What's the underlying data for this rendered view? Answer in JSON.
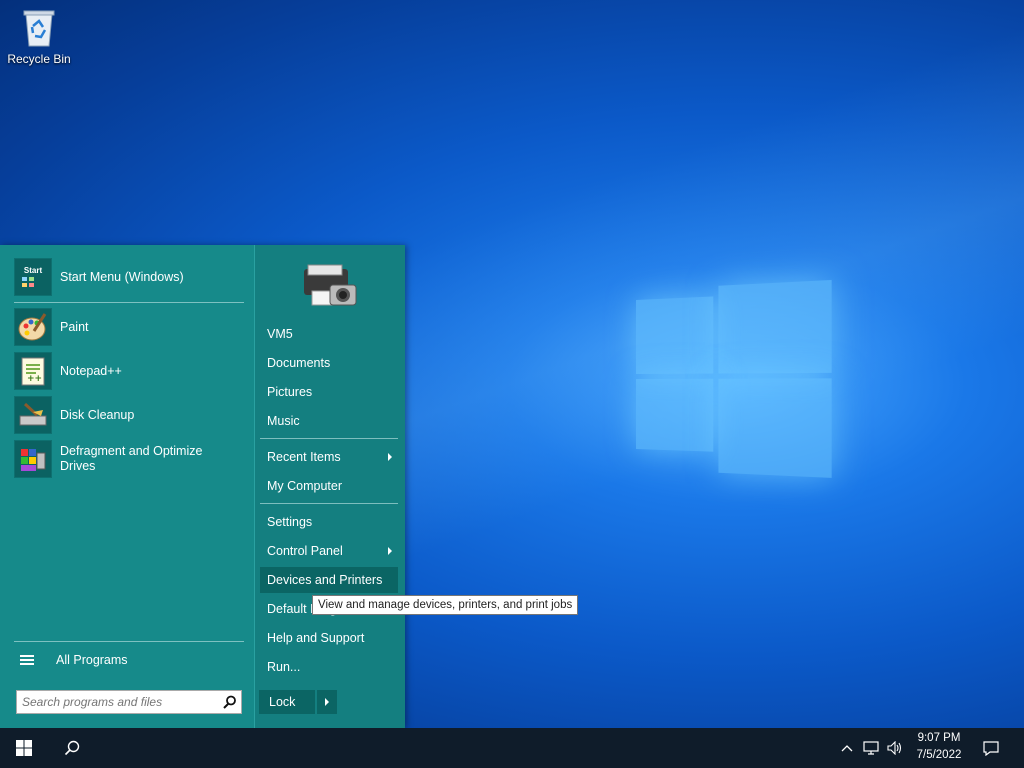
{
  "desktop": {
    "icons": [
      {
        "label": "Recycle Bin",
        "icon": "recycle-bin-icon"
      }
    ]
  },
  "start_menu": {
    "pinned": {
      "label": "Start Menu (Windows)",
      "icon": "start-menu-icon",
      "tile_text": "Start"
    },
    "programs": [
      {
        "label": "Paint",
        "icon": "paint-icon"
      },
      {
        "label": "Notepad++",
        "icon": "notepad-plus-plus-icon"
      },
      {
        "label": "Disk Cleanup",
        "icon": "disk-cleanup-icon"
      },
      {
        "label": "Defragment and Optimize Drives",
        "icon": "defrag-icon"
      }
    ],
    "all_programs_label": "All Programs",
    "search_placeholder": "Search programs and files",
    "right_items": [
      {
        "label": "VM5",
        "submenu": false
      },
      {
        "label": "Documents",
        "submenu": false
      },
      {
        "label": "Pictures",
        "submenu": false
      },
      {
        "label": "Music",
        "submenu": false
      },
      {
        "label": "Recent Items",
        "submenu": true
      },
      {
        "label": "My Computer",
        "submenu": false
      },
      {
        "label": "Settings",
        "submenu": false
      },
      {
        "label": "Control Panel",
        "submenu": true
      },
      {
        "label": "Devices and Printers",
        "submenu": false,
        "highlighted": true
      },
      {
        "label": "Default Programs",
        "submenu": false
      },
      {
        "label": "Help and Support",
        "submenu": false
      },
      {
        "label": "Run...",
        "submenu": false
      }
    ],
    "lock_label": "Lock",
    "tooltip": "View and manage devices, printers, and print jobs",
    "colors": {
      "menu_bg": "#168a8a",
      "highlight": "#0b6564"
    }
  },
  "taskbar": {
    "start_icon": "windows-logo-icon",
    "search_icon": "search-icon",
    "tray": [
      "chevron-up-icon",
      "network-icon",
      "volume-icon"
    ],
    "time": "9:07 PM",
    "date": "7/5/2022",
    "notification_icon": "action-center-icon"
  }
}
